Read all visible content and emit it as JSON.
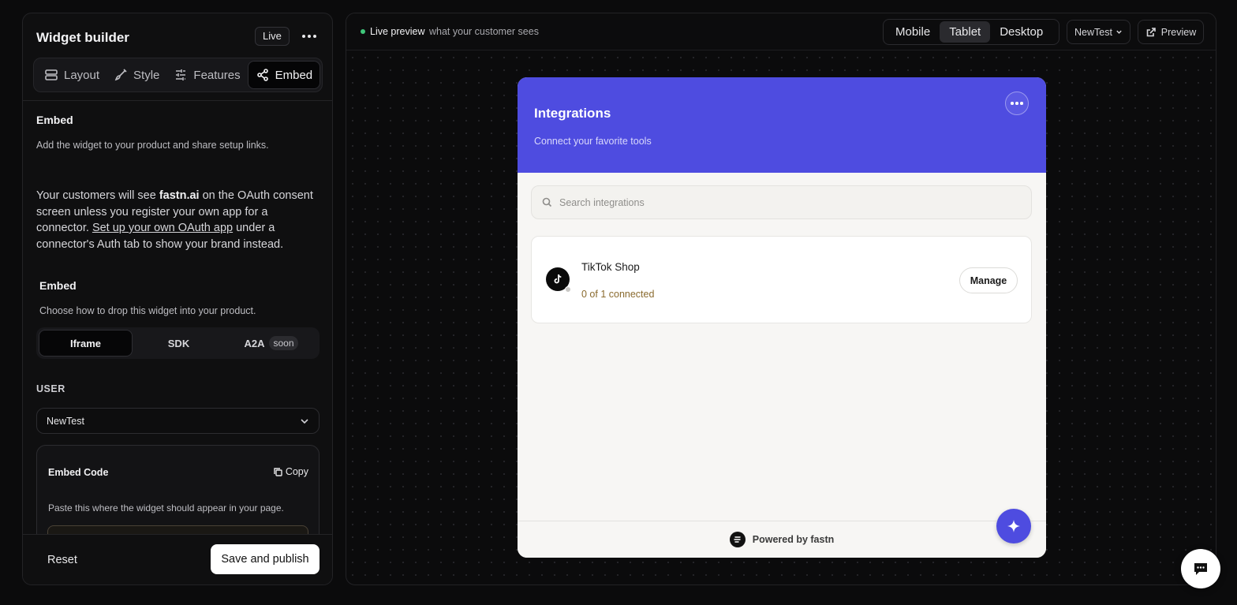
{
  "builder": {
    "title": "Widget builder",
    "status_badge": "Live",
    "tabs": [
      {
        "label": "Layout",
        "icon": "layout-icon"
      },
      {
        "label": "Style",
        "icon": "brush-icon"
      },
      {
        "label": "Features",
        "icon": "sliders-icon"
      },
      {
        "label": "Embed",
        "icon": "share-icon"
      }
    ],
    "active_tab": "Embed"
  },
  "embed_section": {
    "heading": "Embed",
    "description": "Add the widget to your product and share setup links.",
    "oauth_note": {
      "prefix": "Your customers will see ",
      "brand": "fastn.ai",
      "middle": " on the OAuth consent screen unless you register your own app for a connector. ",
      "link": "Set up your own OAuth app",
      "suffix": " under a connector's Auth tab to show your brand instead."
    },
    "method_heading": "Embed",
    "method_description": "Choose how to drop this widget into your product.",
    "methods": [
      {
        "label": "Iframe",
        "badge": ""
      },
      {
        "label": "SDK",
        "badge": ""
      },
      {
        "label": "A2A",
        "badge": "soon"
      }
    ],
    "active_method": "Iframe",
    "user_label": "USER",
    "user_selected": "NewTest",
    "code_card": {
      "title": "Embed Code",
      "copy_label": "Copy",
      "description": "Paste this where the widget should appear in your page."
    }
  },
  "footer": {
    "reset_label": "Reset",
    "save_label": "Save and publish"
  },
  "preview": {
    "live_label": "Live preview",
    "live_sub": "what your customer sees",
    "devices": [
      "Mobile",
      "Tablet",
      "Desktop"
    ],
    "active_device": "Tablet",
    "user_dropdown": "NewTest",
    "preview_button": "Preview"
  },
  "widget": {
    "title": "Integrations",
    "subtitle": "Connect your favorite tools",
    "search_placeholder": "Search integrations",
    "accent_color": "#4e4ce0",
    "integrations": [
      {
        "name": "TikTok Shop",
        "status": "0 of 1 connected",
        "action": "Manage",
        "icon": "tiktok-icon"
      }
    ],
    "powered_by": "Powered by fastn"
  },
  "colors": {
    "background": "#0b0b0c",
    "panel": "#0f0f10",
    "live_dot": "#3fc77a",
    "status_text": "#8a6a2e"
  }
}
